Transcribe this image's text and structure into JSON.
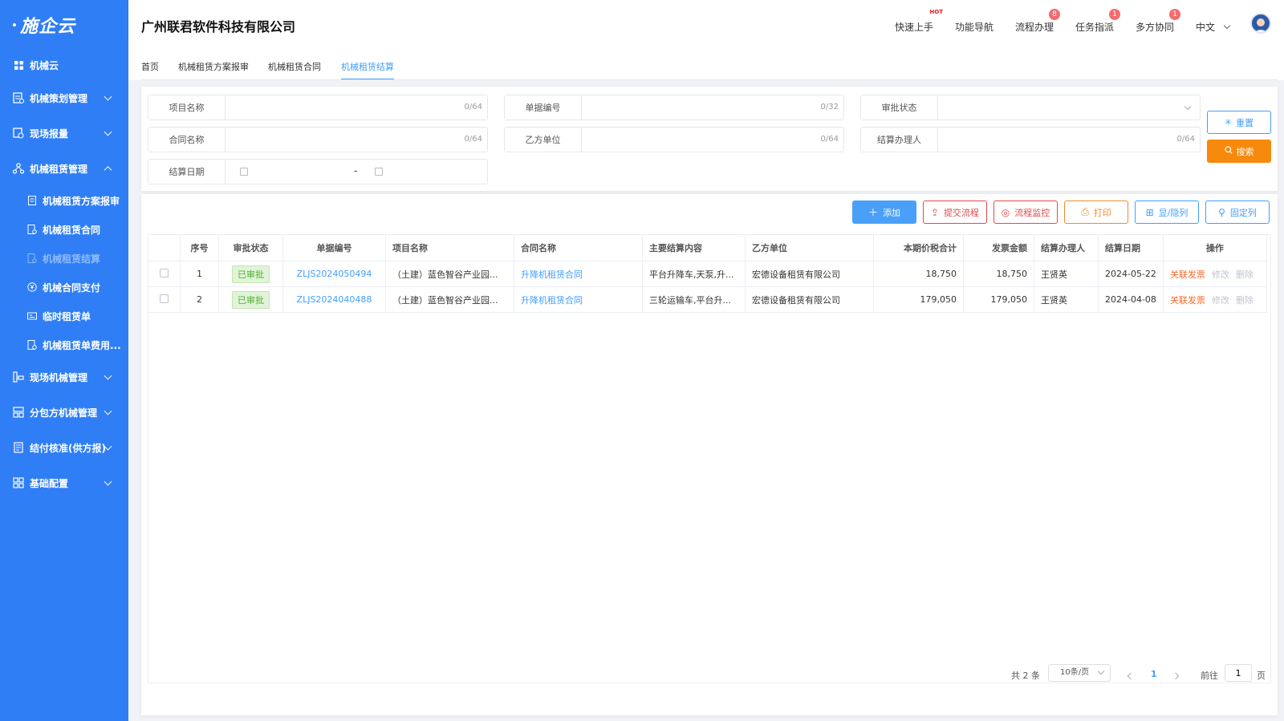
{
  "app": {
    "logo": "施企云",
    "company": "广州联君软件科技有限公司"
  },
  "sidebar": {
    "items": [
      {
        "label": "机械云",
        "icon": "grid-icon"
      },
      {
        "label": "机械策划管理",
        "icon": "plan-icon"
      },
      {
        "label": "现场报量",
        "icon": "report-icon"
      },
      {
        "label": "机械租赁管理",
        "icon": "lease-icon"
      },
      {
        "label": "现场机械管理",
        "icon": "machine-icon"
      },
      {
        "label": "分包方机械管理",
        "icon": "subcontract-icon"
      },
      {
        "label": "结付核准(供方报)",
        "icon": "settle-icon"
      },
      {
        "label": "基础配置",
        "icon": "config-icon"
      }
    ],
    "sub_items": [
      {
        "label": "机械租赁方案报审"
      },
      {
        "label": "机械租赁合同"
      },
      {
        "label": "机械租赁结算"
      },
      {
        "label": "机械合同支付"
      },
      {
        "label": "临时租赁单"
      },
      {
        "label": "机械租赁单费用..."
      }
    ]
  },
  "header": {
    "quick_start": "快速上手",
    "hot": "HOT",
    "nav_guide": "功能导航",
    "process": "流程办理",
    "process_badge": "8",
    "task": "任务指派",
    "task_badge": "1",
    "collab": "多方协同",
    "collab_badge": "1",
    "lang": "中文"
  },
  "tabs": [
    "首页",
    "机械租赁方案报审",
    "机械租赁合同",
    "机械租赁结算"
  ],
  "search": {
    "project_name": {
      "label": "项目名称",
      "value": "",
      "count": "0/64"
    },
    "doc_no": {
      "label": "单据编号",
      "value": "",
      "count": "0/32"
    },
    "approval_status": {
      "label": "审批状态",
      "value": ""
    },
    "contract_name": {
      "label": "合同名称",
      "value": "",
      "count": "0/64"
    },
    "party_b": {
      "label": "乙方单位",
      "value": "",
      "count": "0/64"
    },
    "handler": {
      "label": "结算办理人",
      "value": "",
      "count": "0/64"
    },
    "settle_date": {
      "label": "结算日期",
      "sep": "-"
    },
    "reset_label": "重置",
    "search_label": "搜索"
  },
  "toolbar": {
    "add": "添加",
    "submit": "提交流程",
    "monitor": "流程监控",
    "print": "打印",
    "toggle_cols": "显/隐列",
    "fix_cols": "固定列"
  },
  "table": {
    "headers": [
      "序号",
      "审批状态",
      "单据编号",
      "项目名称",
      "合同名称",
      "主要结算内容",
      "乙方单位",
      "本期价税合计",
      "发票金额",
      "结算办理人",
      "结算日期",
      "操作"
    ],
    "rows": [
      {
        "no": "1",
        "status": "已审批",
        "doc": "ZLJS2024050494",
        "project": "（土建）蓝色智谷产业园...",
        "contract": "升降机租赁合同",
        "content": "平台升降车,天泵,升...",
        "party": "宏德设备租赁有限公司",
        "amount": "18,750",
        "invoice": "18,750",
        "handler": "王贤英",
        "date": "2024-05-22",
        "op1": "关联发票",
        "op2": "修改",
        "op3": "删除"
      },
      {
        "no": "2",
        "status": "已审批",
        "doc": "ZLJS2024040488",
        "project": "（土建）蓝色智谷产业园...",
        "contract": "升降机租赁合同",
        "content": "三轮运输车,平台升...",
        "party": "宏德设备租赁有限公司",
        "amount": "179,050",
        "invoice": "179,050",
        "handler": "王贤英",
        "date": "2024-04-08",
        "op1": "关联发票",
        "op2": "修改",
        "op3": "删除"
      }
    ]
  },
  "pager": {
    "total": "共 2 条",
    "page_size": "10条/页",
    "current": "1",
    "goto_label": "前往",
    "goto_value": "1",
    "page_suffix": "页"
  },
  "colors": {
    "sidebar": "#2f7ef5",
    "primary": "#409eff",
    "search_btn": "#f7890c",
    "danger": "#e34b4b"
  }
}
